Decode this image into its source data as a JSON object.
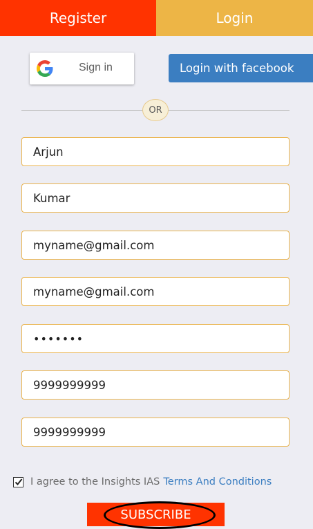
{
  "tabs": {
    "register_label": "Register",
    "login_label": "Login"
  },
  "social": {
    "google_label": "Sign in",
    "facebook_label": "Login with facebook"
  },
  "divider": {
    "or_label": "OR"
  },
  "form": {
    "first_name": "Arjun",
    "last_name": "Kumar",
    "email": "myname@gmail.com",
    "confirm_email": "myname@gmail.com",
    "password_mask": "•••••••",
    "phone": "9999999999",
    "confirm_phone": "9999999999"
  },
  "agreement": {
    "checked": true,
    "text": "I agree to the Insights IAS",
    "link_label": "Terms And Conditions"
  },
  "subscribe_label": "SUBSCRIBE",
  "colors": {
    "register_tab": "#ff3300",
    "login_tab": "#edb546",
    "facebook": "#3b7ec1",
    "field_border": "#e9b24a",
    "background": "#ededf3"
  },
  "icons": {
    "google": "google-g-icon",
    "check": "checkmark-icon"
  }
}
